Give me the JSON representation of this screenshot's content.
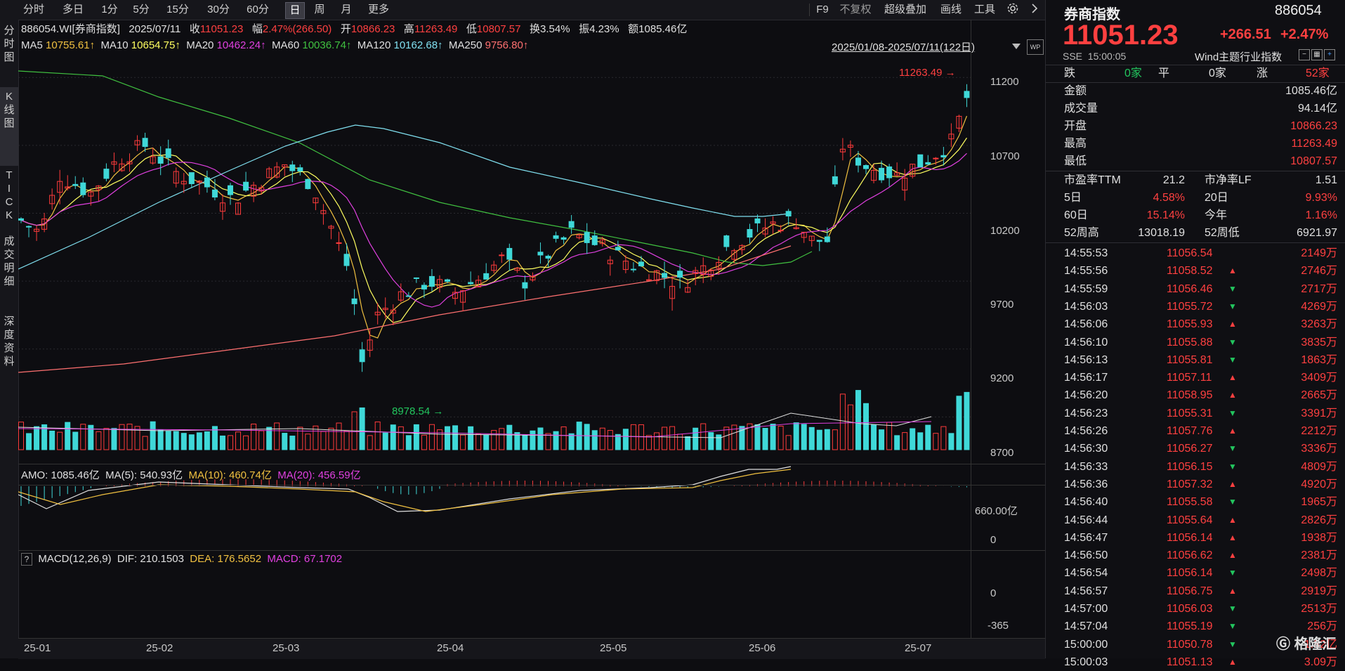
{
  "toolbar": {
    "periods": [
      "分时",
      "多日",
      "1分",
      "5分",
      "15分",
      "30分",
      "60分",
      "日",
      "周",
      "月",
      "更多"
    ],
    "active_period": "日",
    "right_items": [
      "F9",
      "不复权",
      "超级叠加",
      "画线",
      "工具"
    ],
    "gear_icon": "gear-icon",
    "expand_icon": "chevron-right-icon"
  },
  "left_tabs": [
    "分时图",
    "K线图",
    "TICK",
    "成交明细",
    "深度资料"
  ],
  "left_active": "K线图",
  "info": {
    "code": "886054.WI[券商指数]",
    "date": "2025/07/11",
    "close_label": "收",
    "close": "11051.23",
    "chg_label": "幅",
    "chg": "2.47%(266.50)",
    "open_label": "开",
    "open": "10866.23",
    "high_label": "高",
    "high": "11263.49",
    "low_label": "低",
    "low": "10807.57",
    "turnover": "换3.54%",
    "amplitude": "振4.23%",
    "amount": "额1085.46亿"
  },
  "ma": [
    {
      "name": "MA5",
      "value": "10755.61↑",
      "color": "#f0c040"
    },
    {
      "name": "MA10",
      "value": "10654.75↑",
      "color": "#ffff60"
    },
    {
      "name": "MA20",
      "value": "10462.24↑",
      "color": "#e040e0"
    },
    {
      "name": "MA60",
      "value": "10036.74↑",
      "color": "#40c040"
    },
    {
      "name": "MA120",
      "value": "10162.68↑",
      "color": "#80e0f0"
    },
    {
      "name": "MA250",
      "value": "9756.80↑",
      "color": "#ff7070"
    }
  ],
  "range_text": "2025/01/08-2025/07/11(122日)",
  "chart_data": {
    "type": "candlestick",
    "y_ticks": [
      "11200",
      "10700",
      "10200",
      "9700",
      "9200",
      "8700"
    ],
    "ylim": [
      8600,
      11350
    ],
    "x_ticks": [
      "25-01",
      "25-02",
      "25-03",
      "25-04",
      "25-05",
      "25-06",
      "25-07"
    ],
    "high_marker": "11263.49",
    "low_marker": "8978.54",
    "amo_label": "AMO: 1085.46亿",
    "amo_ma": [
      {
        "text": "MA(5): 540.93亿",
        "color": "#e0e0e0"
      },
      {
        "text": "MA(10): 460.74亿",
        "color": "#f0c040"
      },
      {
        "text": "MA(20): 456.59亿",
        "color": "#e040e0"
      }
    ],
    "amo_ticks": [
      "660.00亿",
      "0"
    ],
    "macd_label": "MACD(12,26,9)",
    "macd_dif": "DIF: 210.1503",
    "macd_dea": "DEA: 176.5652",
    "macd_val": "MACD: 67.1702",
    "macd_ticks": [
      "0",
      "-365"
    ],
    "help": "?"
  },
  "right": {
    "name": "券商指数",
    "code": "886054",
    "price": "11051.23",
    "change": "+266.51",
    "pct": "+2.47%",
    "exchange": "SSE",
    "time": "15:00:05",
    "category": "Wind主题行业指数",
    "fall_label": "跌",
    "fall": "0家",
    "flat_label": "平",
    "flat": "0家",
    "rise_label": "涨",
    "rise": "52家",
    "stats": [
      {
        "label": "金额",
        "value": "1085.46亿",
        "color": "#e0e0e0"
      },
      {
        "label": "成交量",
        "value": "94.14亿",
        "color": "#e0e0e0"
      },
      {
        "label": "开盘",
        "value": "10866.23",
        "color": "#ff4040"
      },
      {
        "label": "最高",
        "value": "11263.49",
        "color": "#ff4040"
      },
      {
        "label": "最低",
        "value": "10807.57",
        "color": "#ff4040"
      }
    ],
    "pe_label": "市盈率TTM",
    "pe": "21.2",
    "pb_label": "市净率LF",
    "pb": "1.51",
    "d5_label": "5日",
    "d5": "4.58%",
    "d20_label": "20日",
    "d20": "9.93%",
    "d60_label": "60日",
    "d60": "15.14%",
    "ytd_label": "今年",
    "ytd": "1.16%",
    "h52_label": "52周高",
    "h52": "13018.19",
    "l52_label": "52周低",
    "l52": "6921.97",
    "ticks": [
      {
        "t": "14:55:53",
        "p": "11056.54",
        "d": "",
        "v": "2149万"
      },
      {
        "t": "14:55:56",
        "p": "11058.52",
        "d": "up",
        "v": "2746万"
      },
      {
        "t": "14:55:59",
        "p": "11056.46",
        "d": "down",
        "v": "2717万"
      },
      {
        "t": "14:56:03",
        "p": "11055.72",
        "d": "down",
        "v": "4269万"
      },
      {
        "t": "14:56:06",
        "p": "11055.93",
        "d": "up",
        "v": "3263万"
      },
      {
        "t": "14:56:10",
        "p": "11055.88",
        "d": "down",
        "v": "3835万"
      },
      {
        "t": "14:56:13",
        "p": "11055.81",
        "d": "down",
        "v": "1863万"
      },
      {
        "t": "14:56:17",
        "p": "11057.11",
        "d": "up",
        "v": "3409万"
      },
      {
        "t": "14:56:20",
        "p": "11058.95",
        "d": "up",
        "v": "2665万"
      },
      {
        "t": "14:56:23",
        "p": "11055.31",
        "d": "down",
        "v": "3391万"
      },
      {
        "t": "14:56:26",
        "p": "11057.76",
        "d": "up",
        "v": "2212万"
      },
      {
        "t": "14:56:30",
        "p": "11056.27",
        "d": "down",
        "v": "3336万"
      },
      {
        "t": "14:56:33",
        "p": "11056.15",
        "d": "down",
        "v": "4809万"
      },
      {
        "t": "14:56:36",
        "p": "11057.32",
        "d": "up",
        "v": "4920万"
      },
      {
        "t": "14:56:40",
        "p": "11055.58",
        "d": "down",
        "v": "1965万"
      },
      {
        "t": "14:56:44",
        "p": "11055.64",
        "d": "up",
        "v": "2826万"
      },
      {
        "t": "14:56:47",
        "p": "11056.14",
        "d": "up",
        "v": "1938万"
      },
      {
        "t": "14:56:50",
        "p": "11056.62",
        "d": "up",
        "v": "2381万"
      },
      {
        "t": "14:56:54",
        "p": "11056.14",
        "d": "down",
        "v": "2498万"
      },
      {
        "t": "14:56:57",
        "p": "11056.75",
        "d": "up",
        "v": "2919万"
      },
      {
        "t": "14:57:00",
        "p": "11056.03",
        "d": "down",
        "v": "2513万"
      },
      {
        "t": "14:57:04",
        "p": "11055.19",
        "d": "down",
        "v": "256万"
      },
      {
        "t": "15:00:00",
        "p": "11050.78",
        "d": "down",
        "v": "1.82亿"
      },
      {
        "t": "15:00:03",
        "p": "11051.13",
        "d": "up",
        "v": "3.09万"
      }
    ],
    "watermark": "格隆汇"
  }
}
